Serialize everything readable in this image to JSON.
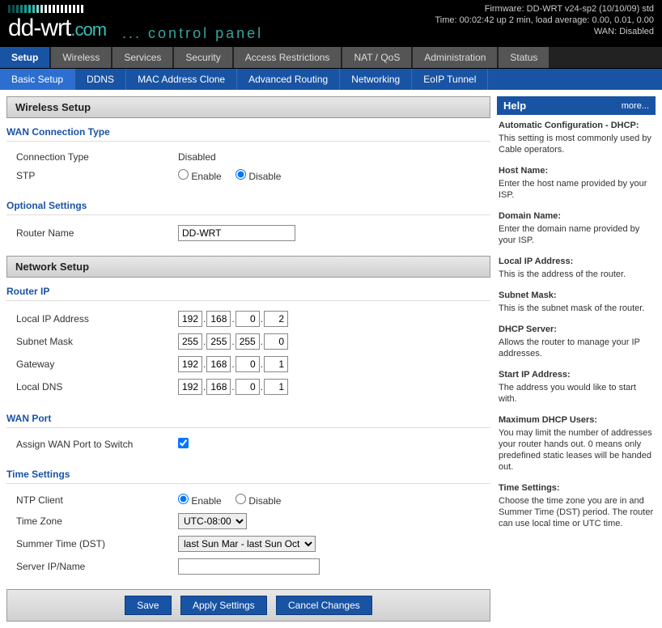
{
  "header": {
    "firmware": "Firmware: DD-WRT v24-sp2 (10/10/09) std",
    "time": "Time: 00:02:42 up 2 min, load average: 0.00, 0.01, 0.00",
    "wan": "WAN: Disabled",
    "logo_dd": "dd-wrt",
    "logo_com": ".com",
    "control_panel": "... control panel"
  },
  "tabs": {
    "setup": "Setup",
    "wireless": "Wireless",
    "services": "Services",
    "security": "Security",
    "access": "Access Restrictions",
    "natqos": "NAT / QoS",
    "admin": "Administration",
    "status": "Status"
  },
  "subtabs": {
    "basic": "Basic Setup",
    "ddns": "DDNS",
    "mac": "MAC Address Clone",
    "routing": "Advanced Routing",
    "networking": "Networking",
    "eoip": "EoIP Tunnel"
  },
  "sections": {
    "wireless_setup": "Wireless Setup",
    "network_setup": "Network Setup"
  },
  "fieldsets": {
    "wan_type": "WAN Connection Type",
    "optional": "Optional Settings",
    "router_ip": "Router IP",
    "wan_port": "WAN Port",
    "time": "Time Settings"
  },
  "labels": {
    "connection_type": "Connection Type",
    "connection_type_value": "Disabled",
    "stp": "STP",
    "enable": "Enable",
    "disable": "Disable",
    "router_name": "Router Name",
    "router_name_value": "DD-WRT",
    "local_ip": "Local IP Address",
    "subnet": "Subnet Mask",
    "gateway": "Gateway",
    "local_dns": "Local DNS",
    "assign_wan": "Assign WAN Port to Switch",
    "ntp_client": "NTP Client",
    "time_zone": "Time Zone",
    "time_zone_value": "UTC-08:00",
    "dst": "Summer Time (DST)",
    "dst_value": "last Sun Mar - last Sun Oct",
    "server_ip": "Server IP/Name"
  },
  "ip": {
    "local": [
      "192",
      "168",
      "0",
      "2"
    ],
    "subnet": [
      "255",
      "255",
      "255",
      "0"
    ],
    "gateway": [
      "192",
      "168",
      "0",
      "1"
    ],
    "dns": [
      "192",
      "168",
      "0",
      "1"
    ]
  },
  "buttons": {
    "save": "Save",
    "apply": "Apply Settings",
    "cancel": "Cancel Changes"
  },
  "help": {
    "title": "Help",
    "more": "more...",
    "items": [
      {
        "t": "Automatic Configuration - DHCP:",
        "d": "This setting is most commonly used by Cable operators."
      },
      {
        "t": "Host Name:",
        "d": "Enter the host name provided by your ISP."
      },
      {
        "t": "Domain Name:",
        "d": "Enter the domain name provided by your ISP."
      },
      {
        "t": "Local IP Address:",
        "d": "This is the address of the router."
      },
      {
        "t": "Subnet Mask:",
        "d": "This is the subnet mask of the router."
      },
      {
        "t": "DHCP Server:",
        "d": "Allows the router to manage your IP addresses."
      },
      {
        "t": "Start IP Address:",
        "d": "The address you would like to start with."
      },
      {
        "t": "Maximum DHCP Users:",
        "d": "You may limit the number of addresses your router hands out. 0 means only predefined static leases will be handed out."
      },
      {
        "t": "Time Settings:",
        "d": "Choose the time zone you are in and Summer Time (DST) period. The router can use local time or UTC time."
      }
    ]
  },
  "tick_colors": [
    "#0a4f4a",
    "#0a4f4a",
    "#0e6b63",
    "#12877c",
    "#16a395",
    "#1abfae",
    "#3cbfb4",
    "#7ed6cf",
    "#bde9e6",
    "#fff",
    "#fff",
    "#fff",
    "#fff",
    "#fff",
    "#fff",
    "#fff",
    "#fff",
    "#fff",
    "#fff"
  ]
}
